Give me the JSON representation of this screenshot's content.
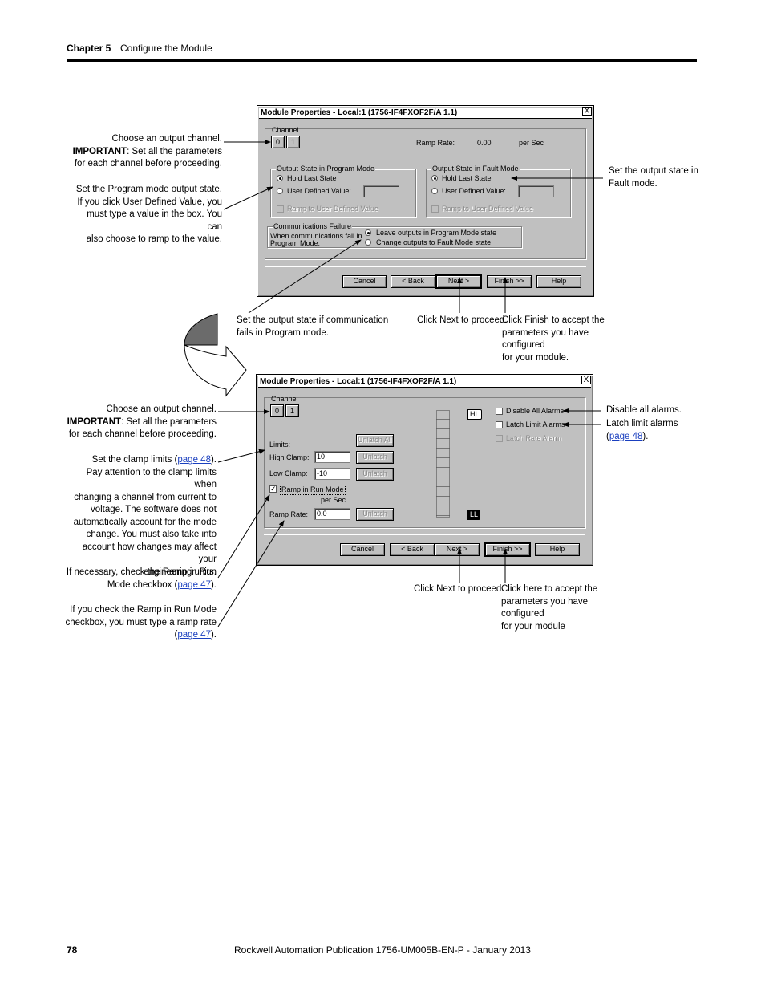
{
  "header": {
    "chapter": "Chapter 5",
    "title": "Configure the Module"
  },
  "footer": {
    "page_number": "78",
    "publication": "Rockwell Automation Publication 1756-UM005B-EN-P - January 2013"
  },
  "dialog1": {
    "title": "Module Properties - Local:1 (1756-IF4FXOF2F/A 1.1)",
    "close": "X",
    "channel_label": "Channel",
    "channels": [
      "0",
      "1"
    ],
    "ramp_rate_label": "Ramp Rate:",
    "ramp_rate_value": "0.00",
    "ramp_rate_unit": "per Sec",
    "program_group": "Output State in Program Mode",
    "program_hold": "Hold Last State",
    "program_user": "User Defined Value:",
    "program_ramp": "Ramp to User Defined Value",
    "fault_group": "Output State in Fault Mode",
    "fault_hold": "Hold Last State",
    "fault_user": "User Defined Value:",
    "fault_ramp": "Ramp to User Defined Value",
    "comm_group": "Communications Failure",
    "comm_text_1": "When communications fail in",
    "comm_text_2": "Program Mode:",
    "comm_opt1": "Leave outputs in Program Mode state",
    "comm_opt2": "Change outputs to Fault Mode state",
    "buttons": {
      "cancel": "Cancel",
      "back": "< Back",
      "next": "Next >",
      "finish": "Finish >>",
      "help": "Help"
    }
  },
  "dialog2": {
    "title": "Module Properties - Local:1 (1756-IF4FXOF2F/A 1.1)",
    "close": "X",
    "channel_label": "Channel",
    "channels": [
      "0",
      "1"
    ],
    "limits_label": "Limits:",
    "high_clamp_label": "High Clamp:",
    "high_clamp_value": "10",
    "low_clamp_label": "Low Clamp:",
    "low_clamp_value": "-10",
    "unlatch_all": "Unlatch All",
    "unlatch": "Unlatch",
    "ramp_run_label": "Ramp in Run Mode",
    "ramp_run_checked": "✓",
    "per_sec": "per Sec",
    "ramp_rate_label": "Ramp Rate:",
    "ramp_rate_value": "0.0",
    "hl": "HL",
    "ll": "LL",
    "disable_alarms": "Disable All Alarms",
    "latch_limit": "Latch Limit Alarms",
    "latch_rate": "Latch Rate Alarm",
    "buttons": {
      "cancel": "Cancel",
      "back": "< Back",
      "next": "Next >",
      "finish": "Finish >>",
      "help": "Help"
    }
  },
  "annotations": {
    "a1_line1": "Choose an output channel.",
    "a1_bold": "IMPORTANT",
    "a1_line2": ": Set all the parameters",
    "a1_line3": "for each channel before proceeding.",
    "a2_line1": "Set the Program mode output state.",
    "a2_line2": "If you click User Defined Value, you",
    "a2_line3": "must type a value in the box. You can",
    "a2_line4": "also choose to ramp to the value.",
    "a3_line1": "Set the output state in",
    "a3_line2": "Fault mode.",
    "a4_line1": "Set the output state if communication",
    "a4_line2": "fails in Program mode.",
    "a5": "Click Next to proceed.",
    "a6_line1": "Click Finish to accept the",
    "a6_line2": "parameters you have configured",
    "a6_line3": "for your module.",
    "b1_line1": "Choose an output channel.",
    "b1_bold": "IMPORTANT",
    "b1_line2": ": Set all the parameters",
    "b1_line3": "for each channel before proceeding.",
    "b2_pre": "Set the clamp limits (",
    "b2_link": "page 48",
    "b2_post": ").",
    "b2_line2": "Pay attention to the clamp limits when",
    "b2_line3": "changing a channel from current to",
    "b2_line4": "voltage. The software does not",
    "b2_line5": "automatically account for the mode",
    "b2_line6": "change. You must also take into",
    "b2_line7": "account how changes may affect your",
    "b2_line8": "engineering units.",
    "b3_line1": "If necessary, check the Ramp in Run",
    "b3_pre": "Mode checkbox (",
    "b3_link": "page 47",
    "b3_post": ").",
    "b4_line1": "If you check the Ramp in Run Mode",
    "b4_line2": "checkbox, you must type a ramp rate",
    "b4_pre": "(",
    "b4_link": "page 47",
    "b4_post": ").",
    "b5": "Disable all alarms.",
    "b6_line1": "Latch limit alarms",
    "b6_pre": "(",
    "b6_link": "page 48",
    "b6_post": ").",
    "b7": "Click Next to proceed.",
    "b8_line1": "Click here to accept the",
    "b8_line2": "parameters you have configured",
    "b8_line3": "for your module"
  }
}
